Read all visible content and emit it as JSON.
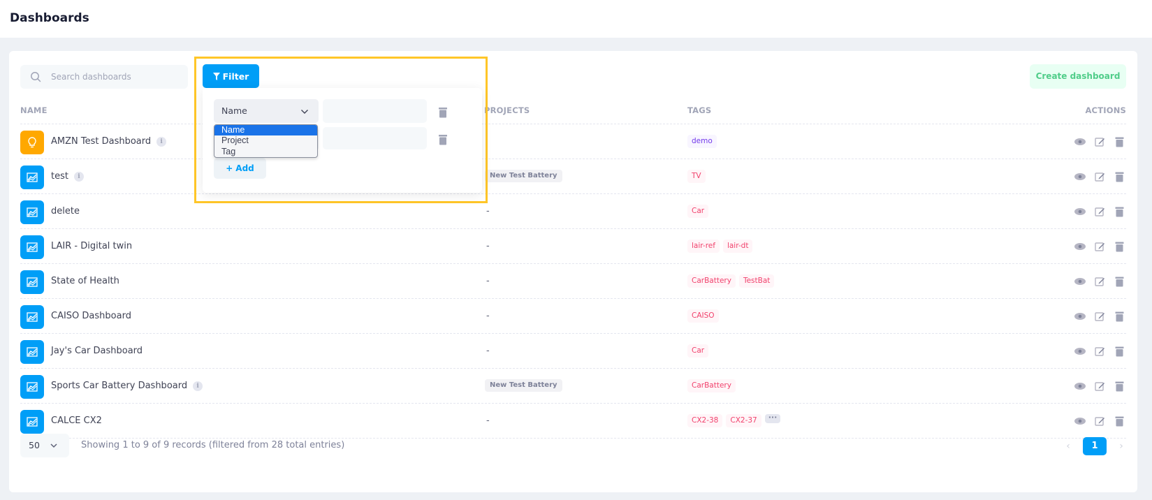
{
  "header": {
    "title": "Dashboards"
  },
  "search": {
    "placeholder": "Search dashboards"
  },
  "create_button": "Create dashboard",
  "columns": {
    "name": "NAME",
    "projects": "PROJECTS",
    "tags": "TAGS",
    "actions": "ACTIONS"
  },
  "rows": [
    {
      "name": "AMZN Test Dashboard",
      "icon": "lightbulb-icon",
      "info": true,
      "project": "",
      "tags": [
        "demo"
      ]
    },
    {
      "name": "test",
      "icon": "chart-icon",
      "info": true,
      "project": "New Test Battery",
      "tags": [
        "TV"
      ]
    },
    {
      "name": "delete",
      "icon": "chart-icon",
      "info": false,
      "project": "-",
      "tags": [
        "Car"
      ]
    },
    {
      "name": "LAIR - Digital twin",
      "icon": "chart-icon",
      "info": false,
      "project": "-",
      "tags": [
        "lair-ref",
        "lair-dt"
      ]
    },
    {
      "name": "State of Health",
      "icon": "chart-icon",
      "info": false,
      "project": "-",
      "tags": [
        "CarBattery",
        "TestBat"
      ]
    },
    {
      "name": "CAISO Dashboard",
      "icon": "chart-icon",
      "info": false,
      "project": "-",
      "tags": [
        "CAISO"
      ]
    },
    {
      "name": "Jay's Car Dashboard",
      "icon": "chart-icon",
      "info": false,
      "project": "-",
      "tags": [
        "Car"
      ]
    },
    {
      "name": "Sports Car Battery Dashboard",
      "icon": "chart-icon",
      "info": true,
      "project": "New Test Battery",
      "tags": [
        "CarBattery"
      ]
    },
    {
      "name": "CALCE CX2",
      "icon": "chart-icon",
      "info": false,
      "project": "-",
      "tags": [
        "CX2-38",
        "CX2-37"
      ],
      "more_tags": "···"
    }
  ],
  "info_glyph": "i",
  "footer": {
    "page_size": "50",
    "records": "Showing 1 to 9 of 9 records (filtered from 28 total entries)",
    "current_page": "1"
  },
  "filter": {
    "button_label": "Filter",
    "field_value": "Name",
    "options": [
      "Name",
      "Project",
      "Tag"
    ],
    "selected_option": "Name",
    "add_label": "Add"
  },
  "colors": {
    "primary": "#009ef7",
    "success": "#50cd89",
    "danger": "#f1416c",
    "warning": "#ffa800",
    "highlight": "#ffc628"
  }
}
